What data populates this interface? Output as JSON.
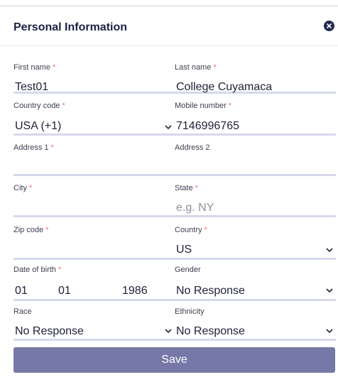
{
  "modal": {
    "title": "Personal Information",
    "close_icon": "close-circle-icon"
  },
  "form": {
    "first_name": {
      "label": "First name",
      "required": "*",
      "value": "Test01"
    },
    "last_name": {
      "label": "Last name",
      "required": "*",
      "value": "College Cuyamaca"
    },
    "country_code": {
      "label": "Country code",
      "required": "*",
      "value": "USA (+1)"
    },
    "mobile_number": {
      "label": "Mobile number",
      "required": "*",
      "value": "7146996765"
    },
    "address1": {
      "label": "Address 1",
      "required": "*",
      "value": ""
    },
    "address2": {
      "label": "Address 2",
      "value": ""
    },
    "city": {
      "label": "City",
      "required": "*",
      "value": ""
    },
    "state": {
      "label": "State",
      "required": "*",
      "placeholder": "e.g. NY"
    },
    "zip_code": {
      "label": "Zip code",
      "required": "*",
      "value": ""
    },
    "country": {
      "label": "Country",
      "required": "*",
      "value": "US"
    },
    "date_of_birth": {
      "label": "Date of birth",
      "required": "*",
      "month": "01",
      "day": "01",
      "year": "1986"
    },
    "gender": {
      "label": "Gender",
      "value": "No Response"
    },
    "race": {
      "label": "Race",
      "value": "No Response"
    },
    "ethnicity": {
      "label": "Ethnicity",
      "value": "No Response"
    }
  },
  "save_label": "Save",
  "colors": {
    "accent": "#7678a8",
    "underline": "#d6d9eb",
    "required": "#ef6f7f",
    "close": "#222a52"
  }
}
